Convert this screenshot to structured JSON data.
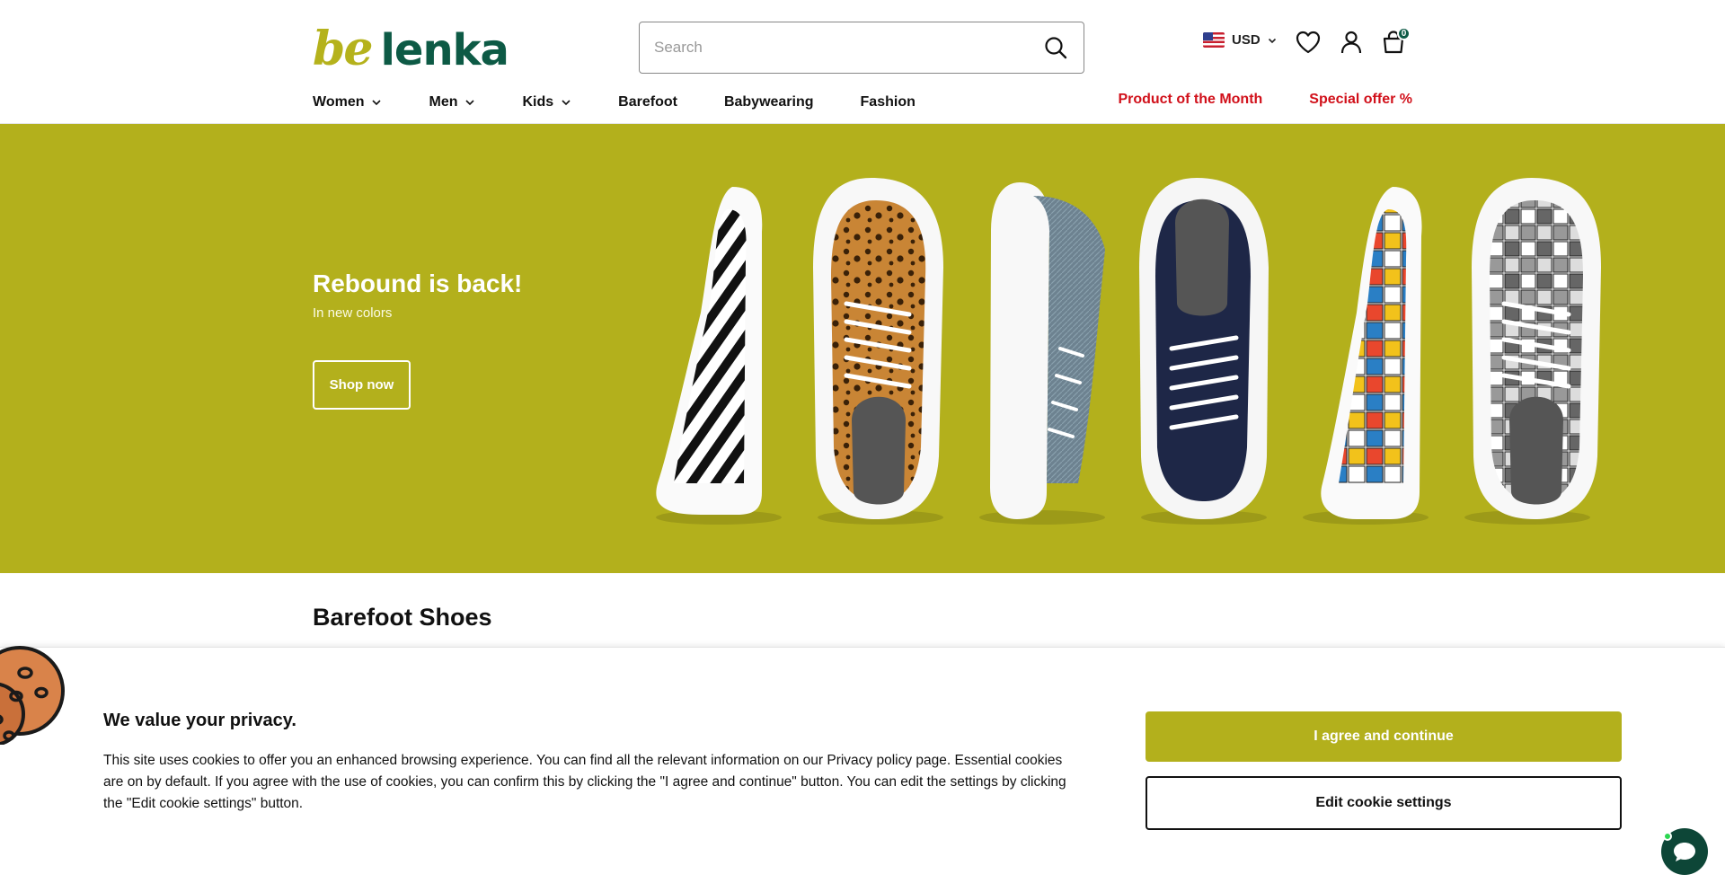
{
  "brand": {
    "logo_be": "be",
    "logo_lenka": "lenka",
    "primary": "#b3b01c",
    "dark_green": "#0d5a45",
    "accent_red": "#d1101a"
  },
  "header": {
    "search_placeholder": "Search",
    "currency": "USD",
    "cart_count": "0",
    "icons": [
      "search-icon",
      "us-flag-icon",
      "chevron-down-icon",
      "heart-icon",
      "user-icon",
      "shopping-bag-icon"
    ]
  },
  "nav": {
    "items": [
      {
        "label": "Women",
        "dropdown": true
      },
      {
        "label": "Men",
        "dropdown": true
      },
      {
        "label": "Kids",
        "dropdown": true
      },
      {
        "label": "Barefoot",
        "dropdown": false
      },
      {
        "label": "Babywearing",
        "dropdown": false
      },
      {
        "label": "Fashion",
        "dropdown": false
      }
    ],
    "right": [
      {
        "label": "Product of the Month"
      },
      {
        "label": "Special offer %"
      }
    ]
  },
  "hero": {
    "title": "Rebound is back!",
    "subtitle": "In new colors",
    "cta": "Shop now",
    "background": "#b3b01c"
  },
  "section": {
    "title": "Barefoot Shoes"
  },
  "cookie": {
    "title": "We value your privacy.",
    "text": "This site uses cookies to offer you an enhanced browsing experience. You can find all the relevant information on our Privacy policy page. Essential cookies are on by default. If you agree with the use of cookies, you can confirm this by clicking the \"I agree and continue\" button. You can edit the settings by clicking the \"Edit cookie settings\" button.",
    "agree_label": "I agree and continue",
    "edit_label": "Edit cookie settings"
  }
}
